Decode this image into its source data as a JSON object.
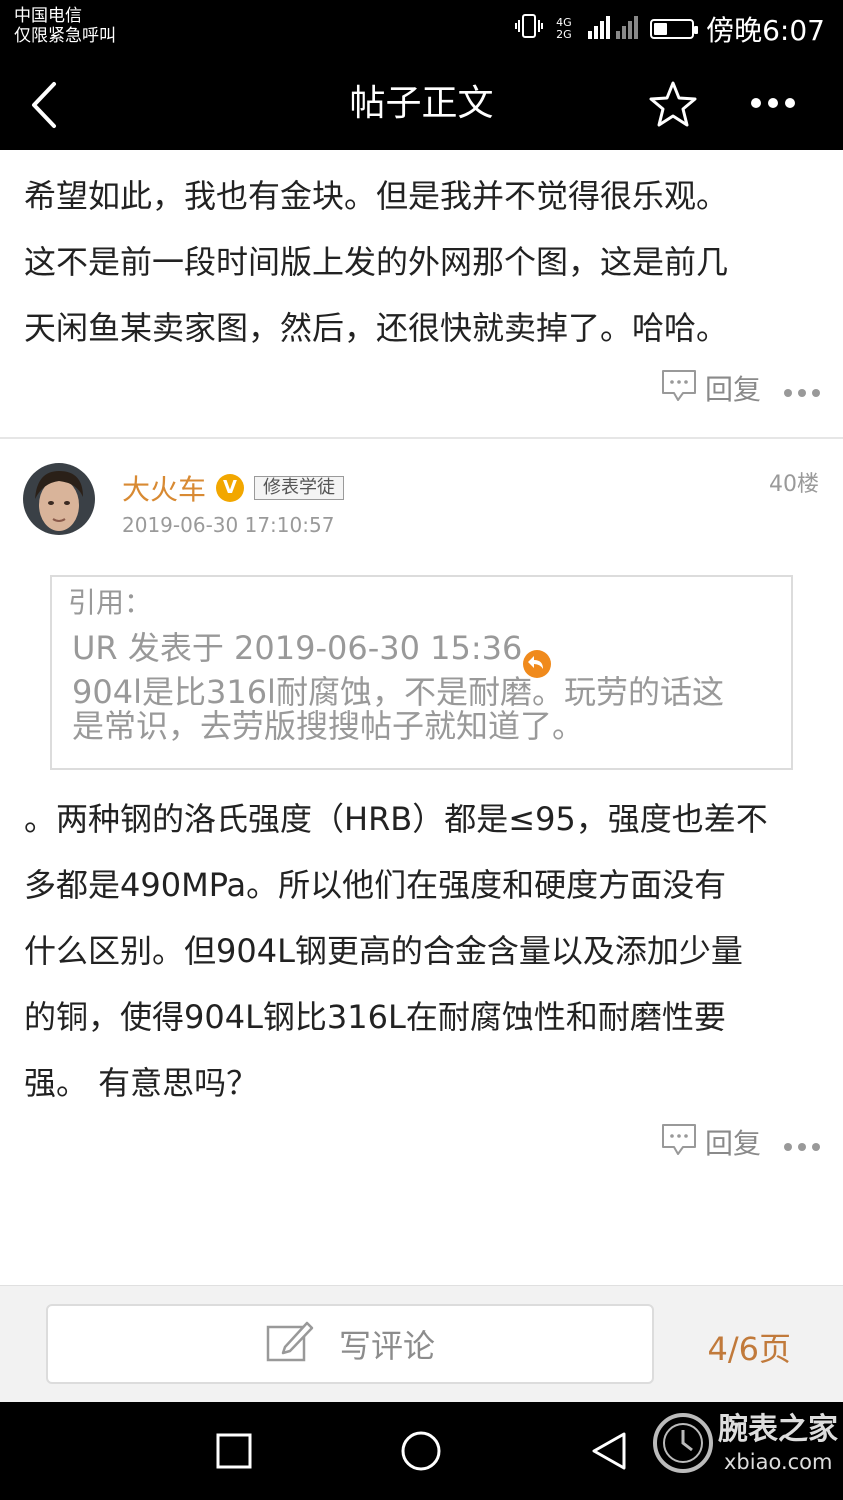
{
  "status_bar": {
    "carrier": "中国电信",
    "carrier_note": "仅限紧急呼叫",
    "network": "4G 2G",
    "battery_level": 0.35,
    "time_label": "傍晚6:07"
  },
  "nav": {
    "title": "帖子正文",
    "back_icon": "chevron-left-icon",
    "favorite_icon": "star-outline-icon",
    "more_icon": "more-dots-icon"
  },
  "post_prev": {
    "lines": [
      "希望如此，我也有金块。但是我并不觉得很乐观。",
      "这不是前一段时间版上发的外网那个图，这是前几",
      "天闲鱼某卖家图，然后，还很快就卖掉了。哈哈。"
    ],
    "reply_label": "回复"
  },
  "post_40": {
    "author": "大火车",
    "verified": "V",
    "rank": "修表学徒",
    "floor": "40楼",
    "timestamp": "2019-06-30 17:10:57",
    "quote": {
      "header": "引用：",
      "source": "UR 发表于 2019-06-30 15:36",
      "lines": [
        "904l是比316l耐腐蚀，不是耐磨。玩劳的话这",
        "是常识，去劳版搜搜帖子就知道了。"
      ]
    },
    "body_lines": [
      "。两种钢的洛氏强度（HRB）都是≤95，强度也差不",
      "多都是490MPa。所以他们在强度和硬度方面没有",
      "什么区别。但904L钢更高的合金含量以及添加少量",
      "的铜，使得904L钢比316L在耐腐蚀性和耐磨性要",
      "强。 有意思吗？"
    ],
    "reply_label": "回复"
  },
  "comment_bar": {
    "placeholder": "写评论",
    "page_indicator": "4/6页"
  },
  "watermark": {
    "name": "腕表之家",
    "domain": "xbiao.com"
  },
  "colors": {
    "author": "#d88a33",
    "page_indicator": "#c17a3b",
    "badge": "#f2a700",
    "quote_back": "#f08a1c"
  }
}
